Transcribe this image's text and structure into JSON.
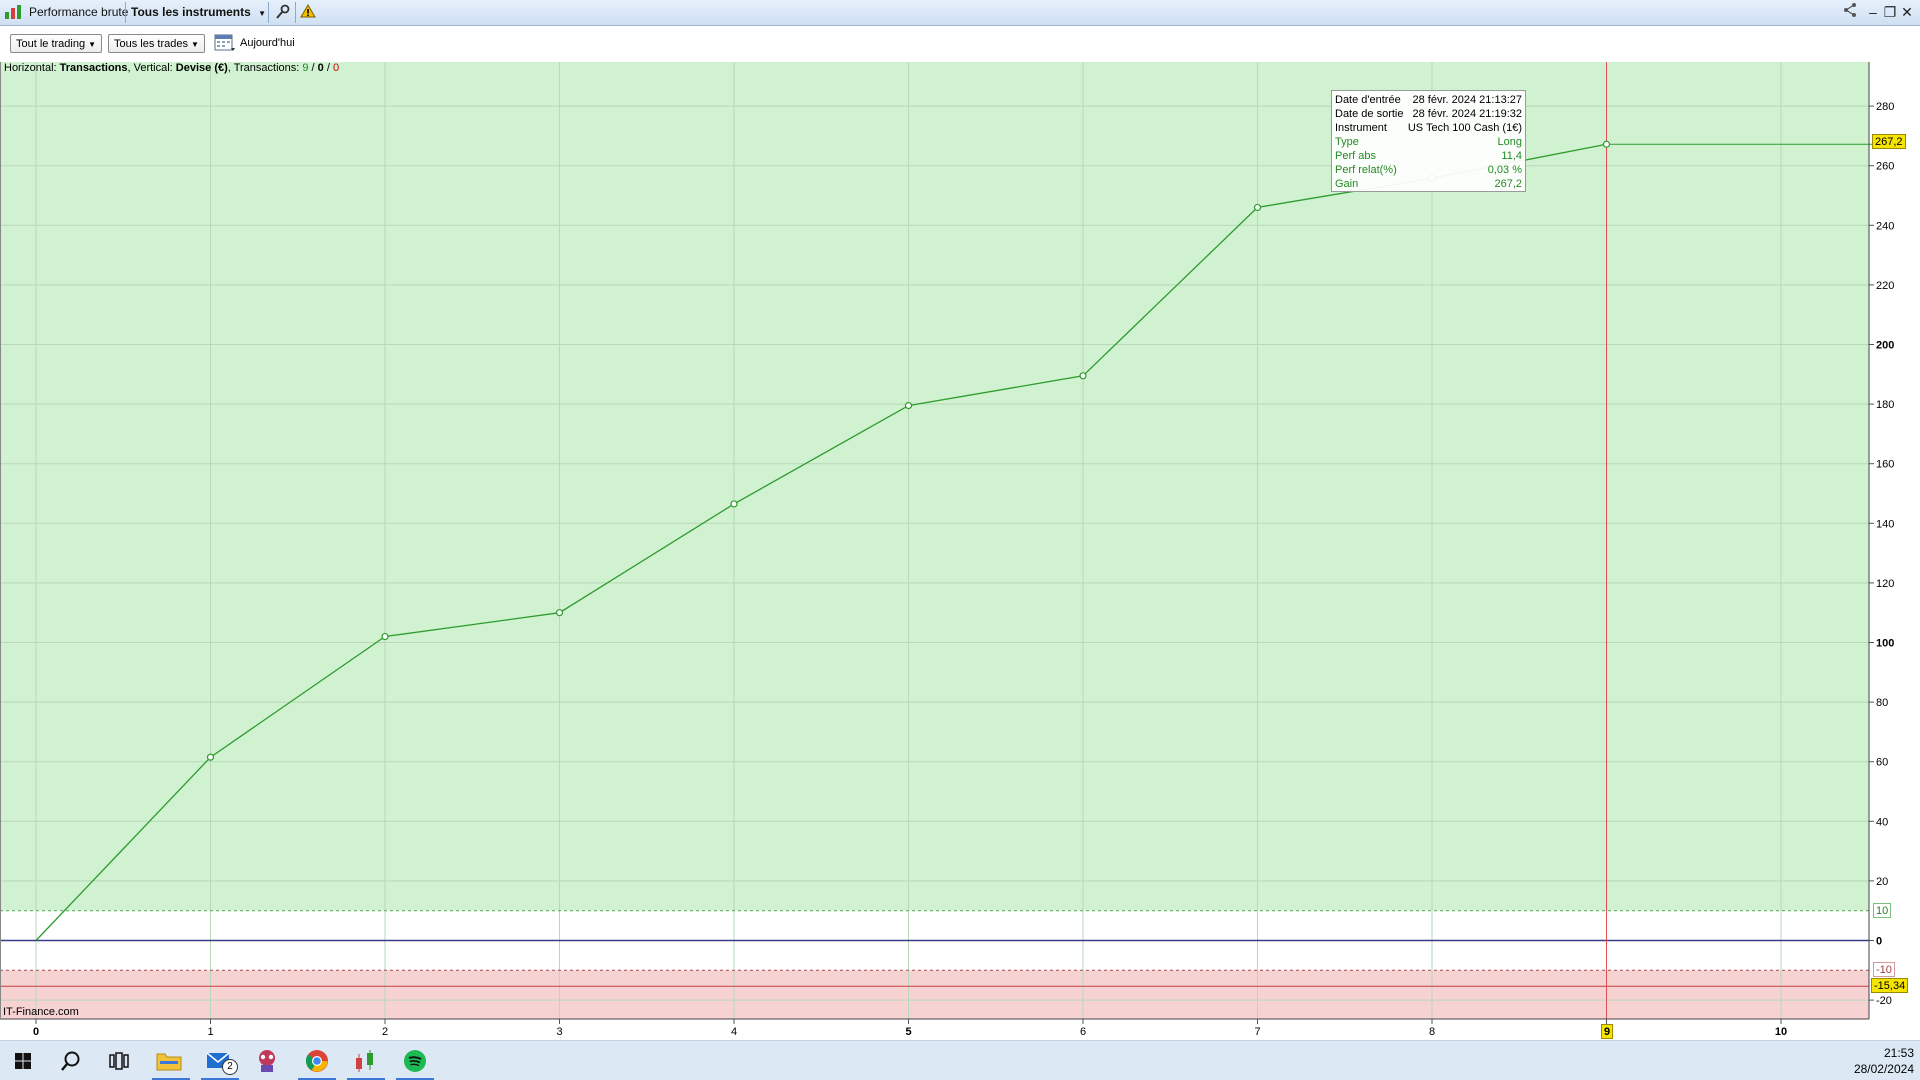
{
  "titlebar": {
    "app_title": "Performance brute",
    "instruments_label": "Tous les instruments"
  },
  "toolbar": {
    "trading_filter": "Tout le trading",
    "trades_filter": "Tous les trades",
    "date_label": "Aujourd'hui"
  },
  "info": {
    "horizontal_prefix": "Horizontal: ",
    "horizontal_value": "Transactions",
    "vertical_prefix": ", Vertical: ",
    "vertical_value": "Devise (€)",
    "transactions_prefix": ", Transactions: ",
    "count_total": "9",
    "count_mid": "0",
    "count_losing": "0",
    "slash": " / "
  },
  "tooltip": {
    "rows": [
      {
        "label": "Date d'entrée",
        "value": "28 févr. 2024 21:13:27"
      },
      {
        "label": "Date de sortie",
        "value": "28 févr. 2024 21:19:32"
      },
      {
        "label": "Instrument",
        "value": "US Tech 100 Cash (1€)"
      },
      {
        "label": "Type",
        "value": "Long"
      },
      {
        "label": "Perf abs",
        "value": "11,4"
      },
      {
        "label": "Perf relat(%)",
        "value": "0,03 %"
      },
      {
        "label": "Gain",
        "value": "267,2"
      }
    ]
  },
  "price_tags": {
    "current": "267,2",
    "upper_threshold": "10",
    "lower_threshold": "-10",
    "min_value": "-15,34"
  },
  "watermark": "IT-Finance.com",
  "clock": {
    "time": "21:53",
    "date": "28/02/2024"
  },
  "mail_badge": "2",
  "colors": {
    "profit_zone": "#d0f2d0",
    "loss_zone": "#f6d2d2",
    "line": "#2e9b2e",
    "cursor": "#e05050",
    "tag_yellow": "#f5e400"
  },
  "chart_data": {
    "type": "line",
    "x": [
      0,
      1,
      2,
      3,
      4,
      5,
      6,
      7,
      8,
      9
    ],
    "values": [
      0,
      61.5,
      102,
      110,
      146.5,
      179.5,
      189.5,
      246,
      255.8,
      267.2
    ],
    "xlim": [
      -0.2,
      10.5
    ],
    "ylim": [
      -26.5,
      293
    ],
    "xticks": [
      "0",
      "1",
      "2",
      "3",
      "4",
      "5",
      "6",
      "7",
      "8",
      "9",
      "10"
    ],
    "yticks": [
      "-20",
      "0",
      "20",
      "40",
      "60",
      "80",
      "100",
      "120",
      "140",
      "160",
      "180",
      "200",
      "220",
      "240",
      "260",
      "280"
    ],
    "grid": true,
    "cursor_x": 9,
    "thresholds": [
      10,
      -10
    ],
    "min_line": -15.34
  }
}
